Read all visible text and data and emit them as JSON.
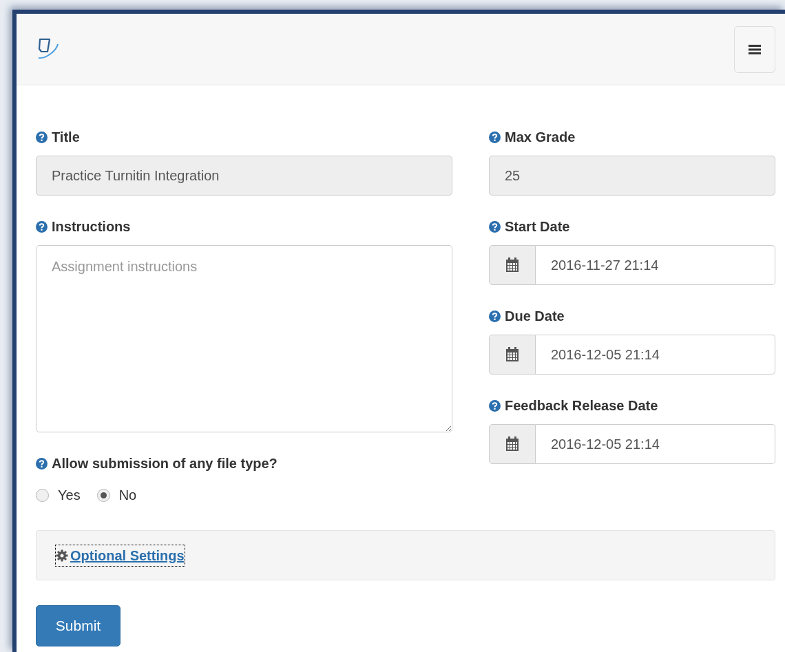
{
  "left_fields": [
    {
      "kind": "text",
      "label": "Title",
      "value": "Practice Turnitin Integration",
      "readonly": true
    },
    {
      "kind": "textarea",
      "label": "Instructions",
      "placeholder": "Assignment instructions"
    },
    {
      "kind": "radio",
      "label": "Allow submission of any file type?",
      "options": [
        {
          "label": "Yes",
          "selected": false
        },
        {
          "label": "No",
          "selected": true
        }
      ]
    }
  ],
  "right_fields": [
    {
      "kind": "text",
      "label": "Max Grade",
      "value": "25",
      "readonly": true
    },
    {
      "kind": "date",
      "label": "Start Date",
      "value": "2016-11-27 21:14",
      "readonly": false
    },
    {
      "kind": "date",
      "label": "Due Date",
      "value": "2016-12-05 21:14",
      "readonly": false
    },
    {
      "kind": "date",
      "label": "Feedback Release Date",
      "value": "2016-12-05 21:14",
      "readonly": false
    }
  ],
  "optional_settings": {
    "label": "Optional Settings"
  },
  "submit_button": "Submit"
}
